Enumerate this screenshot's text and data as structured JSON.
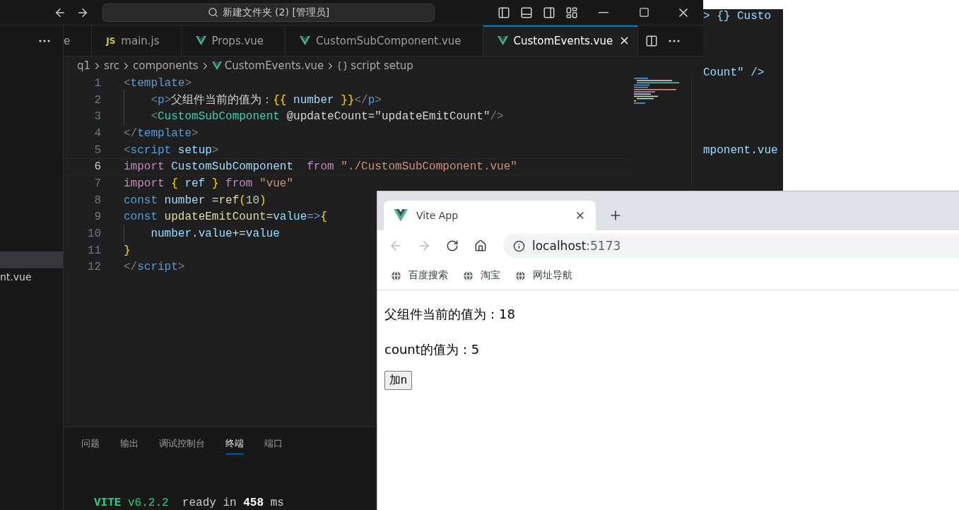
{
  "back_window": {
    "lines": [
      "> {} Custo",
      "Count\" />",
      "mponent.vue"
    ]
  },
  "editor_window": {
    "title": "新建文件夹 (2) [管理员]",
    "sidebar": {
      "items": [
        {
          "selected": true
        },
        {
          "label": "nt.vue",
          "selected": false
        }
      ]
    },
    "tabs": [
      {
        "label": "e",
        "kind": "plain",
        "selected": false
      },
      {
        "label": "main.js",
        "kind": "js",
        "icon_text": "JS",
        "selected": false
      },
      {
        "label": "Props.vue",
        "kind": "vue",
        "selected": false
      },
      {
        "label": "CustomSubComponent.vue",
        "kind": "vue",
        "selected": false
      },
      {
        "label": "CustomEvents.vue",
        "kind": "vue",
        "selected": true
      }
    ],
    "breadcrumb": [
      {
        "label": "q1",
        "kind": "folder"
      },
      {
        "label": "src",
        "kind": "folder"
      },
      {
        "label": "components",
        "kind": "folder"
      },
      {
        "label": "CustomEvents.vue",
        "kind": "vue"
      },
      {
        "label": "script setup",
        "kind": "symbol"
      }
    ],
    "code": [
      {
        "number": "1",
        "current": false,
        "tokens": [
          {
            "text": "<",
            "kind": "punct"
          },
          {
            "text": "template",
            "kind": "tag"
          },
          {
            "text": ">",
            "kind": "punct"
          }
        ]
      },
      {
        "number": "2",
        "current": false,
        "tokens": [
          {
            "text": "    <",
            "kind": "punct"
          },
          {
            "text": "p",
            "kind": "tag"
          },
          {
            "text": ">",
            "kind": "punct"
          },
          {
            "text": "父组件当前的值为：",
            "kind": "text"
          },
          {
            "text": "{{",
            "kind": "brace"
          },
          {
            "text": " number ",
            "kind": "var"
          },
          {
            "text": "}}",
            "kind": "brace"
          },
          {
            "text": "</",
            "kind": "punct"
          },
          {
            "text": "p",
            "kind": "tag"
          },
          {
            "text": ">",
            "kind": "punct"
          }
        ]
      },
      {
        "number": "3",
        "current": false,
        "tokens": [
          {
            "text": "    <",
            "kind": "punct"
          },
          {
            "text": "CustomSubComponent",
            "kind": "component"
          },
          {
            "text": " @updateCount",
            "kind": "text"
          },
          {
            "text": "=",
            "kind": "text"
          },
          {
            "text": "\"updateEmitCount\"",
            "kind": "text"
          },
          {
            "text": "/>",
            "kind": "punct"
          }
        ]
      },
      {
        "number": "4",
        "current": false,
        "tokens": [
          {
            "text": "</",
            "kind": "punct"
          },
          {
            "text": "template",
            "kind": "tag"
          },
          {
            "text": ">",
            "kind": "punct"
          }
        ]
      },
      {
        "number": "5",
        "current": false,
        "tokens": [
          {
            "text": "<",
            "kind": "punct"
          },
          {
            "text": "script",
            "kind": "tag"
          },
          {
            "text": " setup",
            "kind": "var"
          },
          {
            "text": ">",
            "kind": "punct"
          }
        ]
      },
      {
        "number": "6",
        "current": true,
        "tokens": [
          {
            "text": "import",
            "kind": "keyword"
          },
          {
            "text": " CustomSubComponent  ",
            "kind": "var"
          },
          {
            "text": "from",
            "kind": "keyword"
          },
          {
            "text": " \"./CustomSubComponent.vue\"",
            "kind": "string"
          }
        ]
      },
      {
        "number": "7",
        "current": false,
        "tokens": [
          {
            "text": "import",
            "kind": "keyword"
          },
          {
            "text": " {",
            "kind": "brace"
          },
          {
            "text": " ref ",
            "kind": "var"
          },
          {
            "text": "}",
            "kind": "brace"
          },
          {
            "text": " from",
            "kind": "keyword"
          },
          {
            "text": " \"vue\"",
            "kind": "string"
          }
        ]
      },
      {
        "number": "8",
        "current": false,
        "tokens": [
          {
            "text": "const",
            "kind": "storage"
          },
          {
            "text": " number",
            "kind": "var"
          },
          {
            "text": " =",
            "kind": "text"
          },
          {
            "text": "ref",
            "kind": "func"
          },
          {
            "text": "(",
            "kind": "brace"
          },
          {
            "text": "10",
            "kind": "number"
          },
          {
            "text": ")",
            "kind": "brace"
          }
        ]
      },
      {
        "number": "9",
        "current": false,
        "tokens": [
          {
            "text": "const",
            "kind": "storage"
          },
          {
            "text": " updateEmitCount",
            "kind": "func"
          },
          {
            "text": "=",
            "kind": "text"
          },
          {
            "text": "value",
            "kind": "var"
          },
          {
            "text": "=>",
            "kind": "storage"
          },
          {
            "text": "{",
            "kind": "brace"
          }
        ]
      },
      {
        "number": "10",
        "current": false,
        "tokens": [
          {
            "text": "    number",
            "kind": "var"
          },
          {
            "text": ".",
            "kind": "text"
          },
          {
            "text": "value",
            "kind": "var"
          },
          {
            "text": "+=",
            "kind": "text"
          },
          {
            "text": "value",
            "kind": "var"
          }
        ]
      },
      {
        "number": "11",
        "current": false,
        "tokens": [
          {
            "text": "}",
            "kind": "brace"
          }
        ]
      },
      {
        "number": "12",
        "current": false,
        "tokens": [
          {
            "text": "</",
            "kind": "punct"
          },
          {
            "text": "script",
            "kind": "tag"
          },
          {
            "text": ">",
            "kind": "punct"
          }
        ]
      }
    ],
    "panel_tabs": [
      {
        "label": "问题",
        "selected": false
      },
      {
        "label": "输出",
        "selected": false
      },
      {
        "label": "调试控制台",
        "selected": false
      },
      {
        "label": "终端",
        "selected": true
      },
      {
        "label": "端口",
        "selected": false
      }
    ],
    "terminal": [
      {
        "text": "VITE",
        "kind": "brand"
      },
      {
        "text": " v6.2.2",
        "kind": "version"
      },
      {
        "text": "  ready in ",
        "kind": "plain"
      },
      {
        "text": "458",
        "kind": "bold"
      },
      {
        "text": " ms",
        "kind": "plain"
      }
    ]
  },
  "browser": {
    "tab": {
      "title": "Vite App"
    },
    "nav": {
      "back_disabled": true,
      "forward_disabled": true
    },
    "address": {
      "host": "localhost",
      "port": ":5173"
    },
    "bookmarks": [
      "百度搜索",
      "淘宝",
      "网址导航"
    ],
    "page": {
      "lines": [
        "父组件当前的值为：18",
        "count的值为：5"
      ],
      "button": "加n"
    }
  }
}
